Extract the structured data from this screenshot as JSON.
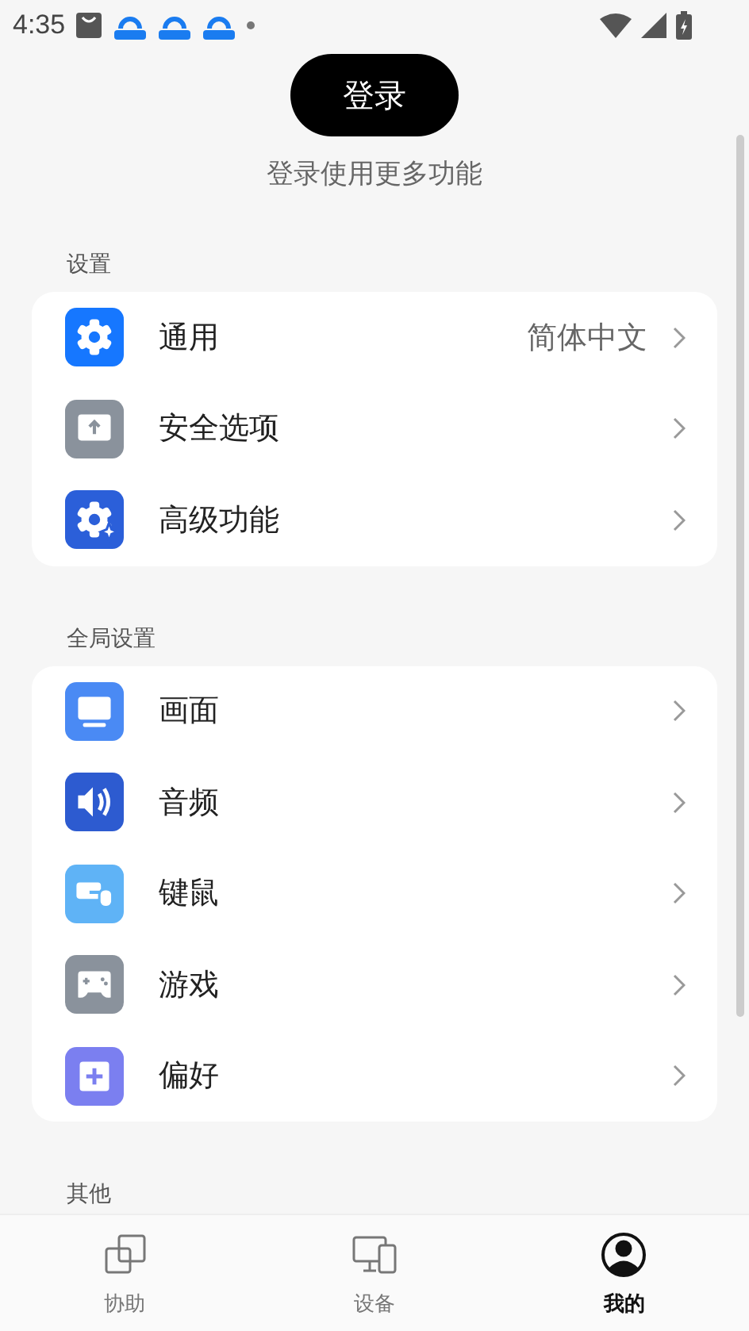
{
  "status_bar": {
    "time": "4:35"
  },
  "login": {
    "button": "登录",
    "subtitle": "登录使用更多功能"
  },
  "sections": [
    {
      "title": "设置",
      "items": [
        {
          "kind": "gear",
          "color": "#1677ff",
          "label": "通用",
          "value": "简体中文"
        },
        {
          "kind": "upload",
          "color": "#8a929c",
          "label": "安全选项"
        },
        {
          "kind": "sparkle-gear",
          "color": "#2b5fd9",
          "label": "高级功能"
        }
      ]
    },
    {
      "title": "全局设置",
      "items": [
        {
          "kind": "monitor",
          "color": "#4a8af4",
          "label": "画面"
        },
        {
          "kind": "speaker",
          "color": "#2d5bd0",
          "label": "音频"
        },
        {
          "kind": "keyboard-mouse",
          "color": "#5fb3f6",
          "label": "键鼠"
        },
        {
          "kind": "gamepad",
          "color": "#8a929c",
          "label": "游戏"
        },
        {
          "kind": "plus",
          "color": "#7b7ff0",
          "label": "偏好"
        }
      ]
    },
    {
      "title": "其他"
    }
  ],
  "nav": [
    {
      "label": "协助",
      "kind": "windows",
      "selected": false
    },
    {
      "label": "设备",
      "kind": "devices",
      "selected": false
    },
    {
      "label": "我的",
      "kind": "profile",
      "selected": true
    }
  ]
}
